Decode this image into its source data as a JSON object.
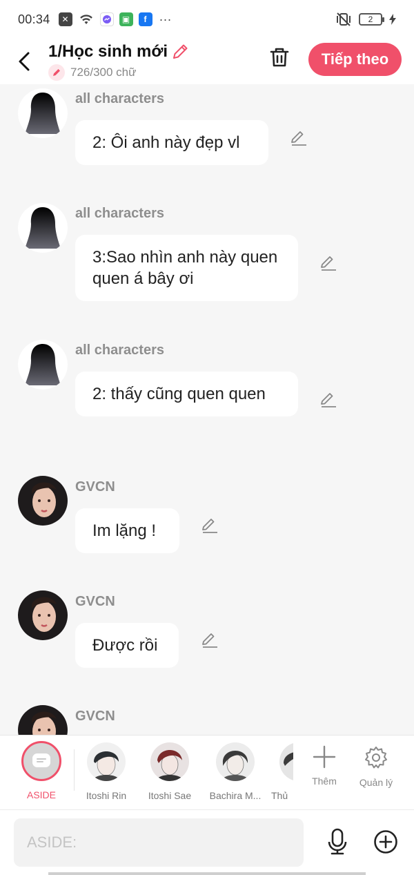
{
  "status_bar": {
    "time": "00:34",
    "battery": "2"
  },
  "header": {
    "title": "1/Học sinh mới",
    "word_count": "726/300 chữ",
    "next_label": "Tiếp theo",
    "accent": "#f0506a"
  },
  "messages": [
    {
      "author": "all characters",
      "text": "2: Ôi anh này đẹp vl",
      "avatar": "silhouette"
    },
    {
      "author": "all characters",
      "text": "3:Sao nhìn anh này quen quen á bây ơi",
      "avatar": "silhouette"
    },
    {
      "author": "all characters",
      "text": "2: thấy cũng quen quen",
      "avatar": "silhouette"
    },
    {
      "author": "GVCN",
      "text": "Im lặng !",
      "avatar": "portrait"
    },
    {
      "author": "GVCN",
      "text": "Được rồi",
      "avatar": "portrait"
    },
    {
      "author": "GVCN",
      "text": "",
      "avatar": "portrait"
    }
  ],
  "character_bar": {
    "aside_label": "ASIDE",
    "characters": [
      {
        "name": "Itoshi Rin"
      },
      {
        "name": "Itoshi Sae"
      },
      {
        "name": "Bachira M..."
      },
      {
        "name": "Thủ"
      }
    ],
    "add_label": "Thêm",
    "manage_label": "Quản lý"
  },
  "input": {
    "placeholder": "ASIDE:"
  }
}
